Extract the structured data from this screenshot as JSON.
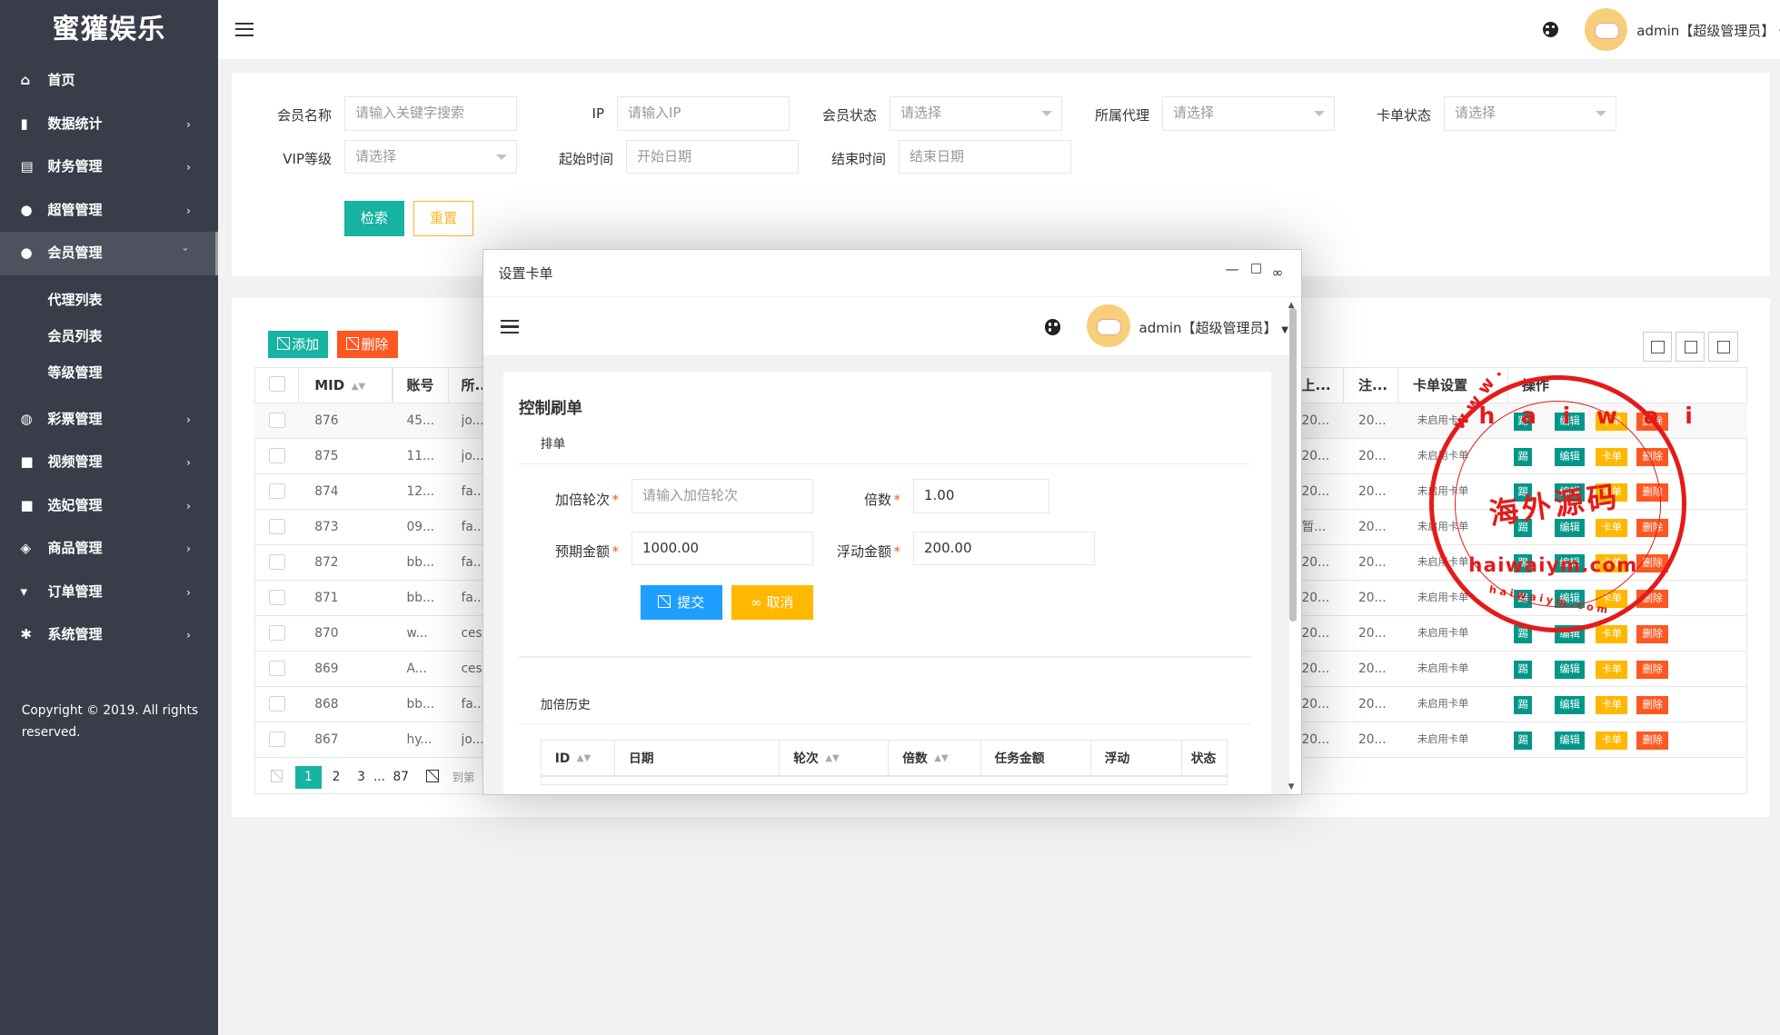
{
  "app": {
    "logo": "蜜獾娱乐",
    "copyright": "Copyright © 2019. All rights reserved."
  },
  "sidebar": {
    "items": [
      {
        "label": "首页",
        "icon": "home-icon"
      },
      {
        "label": "数据统计",
        "icon": "bar-chart-icon"
      },
      {
        "label": "财务管理",
        "icon": "bank-icon"
      },
      {
        "label": "超管管理",
        "icon": "user-icon"
      },
      {
        "label": "会员管理",
        "icon": "users-icon"
      },
      {
        "label": "彩票管理",
        "icon": "gamepad-icon"
      },
      {
        "label": "视频管理",
        "icon": "video-icon"
      },
      {
        "label": "选妃管理",
        "icon": "video-icon"
      },
      {
        "label": "商品管理",
        "icon": "cube-icon"
      },
      {
        "label": "订单管理",
        "icon": "cart-icon"
      },
      {
        "label": "系统管理",
        "icon": "gear-icon"
      }
    ],
    "sub_items": [
      "代理列表",
      "会员列表",
      "等级管理"
    ]
  },
  "header": {
    "user": "admin【超级管理员】"
  },
  "search": {
    "member_name_label": "会员名称",
    "member_name_placeholder": "请输入关键字搜索",
    "ip_label": "IP",
    "ip_placeholder": "请输入IP",
    "status_label": "会员状态",
    "status_value": "请选择",
    "agent_label": "所属代理",
    "agent_value": "请选择",
    "card_status_label": "卡单状态",
    "card_status_value": "请选择",
    "vip_label": "VIP等级",
    "vip_value": "请选择",
    "start_label": "起始时间",
    "start_placeholder": "开始日期",
    "end_label": "结束时间",
    "end_placeholder": "结束日期",
    "search_btn": "检索",
    "reset_btn": "重置"
  },
  "table": {
    "add_btn": "添加",
    "delete_btn": "删除",
    "headers": {
      "mid": "MID",
      "account": "账号",
      "agent": "所...",
      "up": "上...",
      "reg": "注...",
      "card": "卡单设置",
      "ops": "操作"
    },
    "rows": [
      {
        "mid": "876",
        "acc": "45...",
        "ag": "jo...",
        "up": "20...",
        "reg": "20...",
        "card": "未启用卡单"
      },
      {
        "mid": "875",
        "acc": "11...",
        "ag": "jo...",
        "up": "20...",
        "reg": "20...",
        "card": "未启用卡单"
      },
      {
        "mid": "874",
        "acc": "12...",
        "ag": "fa...",
        "up": "20...",
        "reg": "20...",
        "card": "未启用卡单"
      },
      {
        "mid": "873",
        "acc": "09...",
        "ag": "fa...",
        "up": "暂...",
        "reg": "20...",
        "card": "未启用卡单"
      },
      {
        "mid": "872",
        "acc": "bb...",
        "ag": "fa...",
        "up": "20...",
        "reg": "20...",
        "card": "未启用卡单"
      },
      {
        "mid": "871",
        "acc": "bb...",
        "ag": "fa...",
        "up": "20...",
        "reg": "20...",
        "card": "未启用卡单"
      },
      {
        "mid": "870",
        "acc": "w...",
        "ag": "ces",
        "up": "20...",
        "reg": "20...",
        "card": "未启用卡单"
      },
      {
        "mid": "869",
        "acc": "A...",
        "ag": "ces",
        "up": "20...",
        "reg": "20...",
        "card": "未启用卡单"
      },
      {
        "mid": "868",
        "acc": "bb...",
        "ag": "fa...",
        "up": "20...",
        "reg": "20...",
        "card": "未启用卡单"
      },
      {
        "mid": "867",
        "acc": "hy...",
        "ag": "jo...",
        "up": "20...",
        "reg": "20...",
        "card": "未启用卡单"
      }
    ],
    "op_labels": {
      "kick": "踢",
      "edit": "编辑",
      "card": "卡单",
      "del": "删除"
    },
    "pager": {
      "p1": "1",
      "p2": "2",
      "p3": "3",
      "dots": "...",
      "last": "87",
      "goto": "到第"
    }
  },
  "modal": {
    "title": "设置卡单",
    "user": "admin【超级管理员】",
    "heading": "控制刷单",
    "section1": "排单",
    "rounds_label": "加倍轮次",
    "rounds_placeholder": "请输入加倍轮次",
    "multiple_label": "倍数",
    "multiple_value": "1.00",
    "expected_label": "预期金额",
    "expected_value": "1000.00",
    "float_label": "浮动金额",
    "float_value": "200.00",
    "submit": "提交",
    "cancel": "取消",
    "section2": "加倍历史",
    "hist_headers": {
      "id": "ID",
      "date": "日期",
      "round": "轮次",
      "mult": "倍数",
      "amount": "任务金额",
      "float": "浮动",
      "status": "状态"
    }
  },
  "watermark": {
    "top": "www.haiwaiym.com",
    "center": "海外源码",
    "domain": "haiwaiym.com",
    "small": "haiwaiym.com"
  }
}
